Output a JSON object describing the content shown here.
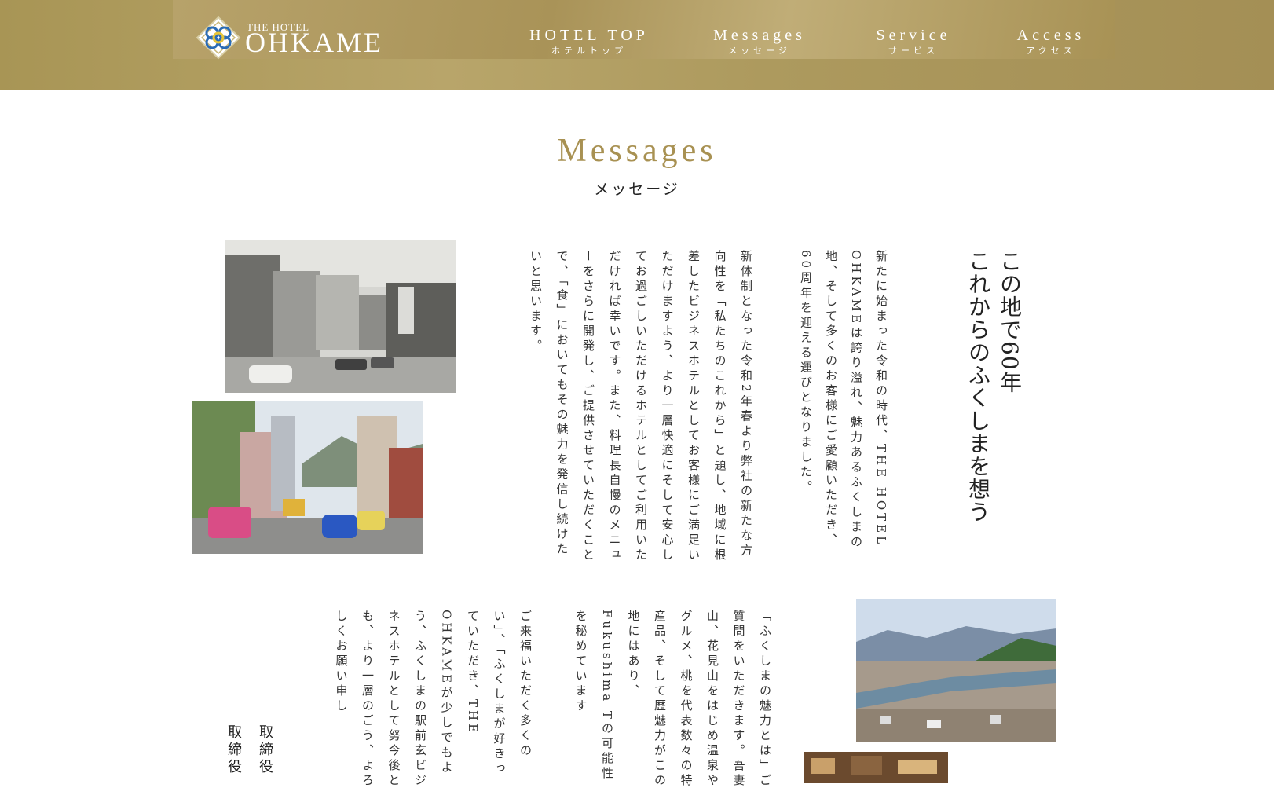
{
  "header": {
    "logo_small": "THE HOTEL",
    "logo_big": "OHKAME",
    "nav": [
      {
        "en": "HOTEL TOP",
        "ja": "ホテルトップ"
      },
      {
        "en": "Messages",
        "ja": "メッセージ"
      },
      {
        "en": "Service",
        "ja": "サービス"
      },
      {
        "en": "Access",
        "ja": "アクセス"
      }
    ]
  },
  "page": {
    "title": "Messages",
    "subtitle": "メッセージ"
  },
  "message": {
    "heading_line1": "この地で60年",
    "heading_line2": "これからのふくしまを想う",
    "para1": "新たに始まった令和の時代、THE HOTEL OHKAMEは誇り溢れ、魅力あるふくしまの地、そして多くのお客様にご愛顧いただき、60周年を迎える運びとなりました。",
    "para2": "新体制となった令和2年春より弊社の新たな方向性を「私たちのこれから」と題し、地域に根差したビジネスホテルとしてお客様にご満足いただけますよう、より一層快適にそして安心してお過ごしいただけるホテルとしてご利用いただければ幸いです。また、料理長自慢のメニューをさらに開発し、ご提供させていただくことで、「食」においてもその魅力を発信し続けたいと思います。",
    "para3": "「ふくしまの魅力とは」ご質問をいただきます。吾妻山、花見山をはじめ温泉やグルメ、桃を代表数々の特産品、そして歴魅力がこの地にはあり、Fukushima Tの可能性を秘めています",
    "para4": "ご来福いただく多くのい」、「ふくしまが好きっていただき、THE OHKAMEが少しでもよう、ふくしまの駅前玄ビジネスホテルとして努今後とも、より一層のごう、よろしくお願い申し",
    "sign_line1": "取締役",
    "sign_line2": "取締役"
  },
  "colors": {
    "gold": "#a89152",
    "header_bg": "#ae9a5f",
    "text": "#333333"
  },
  "icons": {
    "logo": "ohkame-diamond-logo-icon"
  }
}
